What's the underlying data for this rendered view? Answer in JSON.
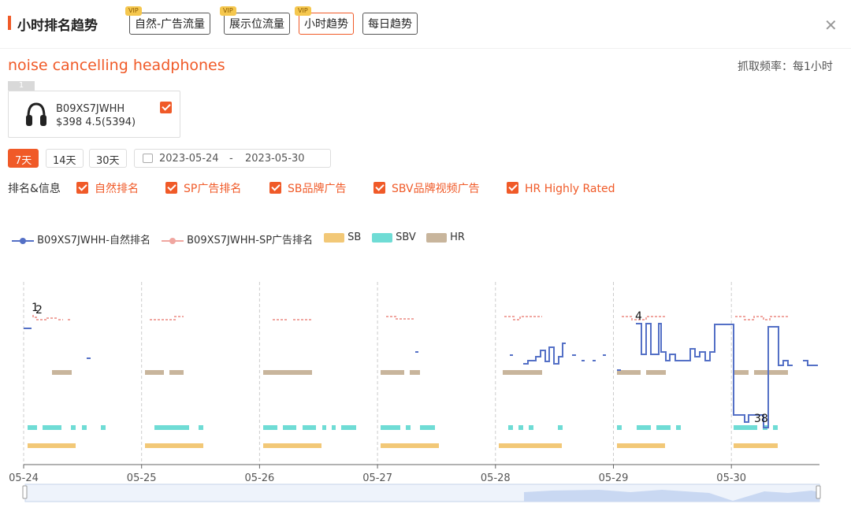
{
  "header": {
    "title": "小时排名趋势",
    "tabs": [
      {
        "label": "自然-广告流量",
        "vip": "VIP",
        "active": false
      },
      {
        "label": "展示位流量",
        "vip": "VIP",
        "active": false
      },
      {
        "label": "小时趋势",
        "vip": "VIP",
        "active": true
      },
      {
        "label": "每日趋势",
        "vip": "",
        "active": false
      }
    ],
    "close_icon": "close-icon"
  },
  "keyword": "noise cancelling headphones",
  "frequency": "抓取频率：每1小时",
  "product": {
    "tag": "1",
    "asin": "B09XS7JWHH",
    "price_rating": "$398 4.5(5394)",
    "checked": true
  },
  "range": {
    "buttons": [
      "7天",
      "14天",
      "30天"
    ],
    "active": "7天",
    "start": "2023-05-24",
    "separator": "-",
    "end": "2023-05-30"
  },
  "filters": {
    "label": "排名&信息",
    "items": [
      "自然排名",
      "SP广告排名",
      "SB品牌广告",
      "SBV品牌视频广告",
      "HR Highly Rated"
    ]
  },
  "legend": [
    {
      "name": "B09XS7JWHH-自然排名",
      "color": "#5470c6"
    },
    {
      "name": "B09XS7JWHH-SP广告排名",
      "color": "#f0a6a0"
    },
    {
      "name": "SB",
      "color": "#f2c877"
    },
    {
      "name": "SBV",
      "color": "#6fdcd5"
    },
    {
      "name": "HR",
      "color": "#c8b59c"
    }
  ],
  "chart_data": {
    "type": "line",
    "x_categories": [
      "05-24",
      "05-25",
      "05-26",
      "05-27",
      "05-28",
      "05-29",
      "05-30"
    ],
    "y_axis": "rank (inverted)",
    "grid": "vertical dashed day separators",
    "annotations": [
      {
        "text": "1",
        "day": "05-24"
      },
      {
        "text": "2",
        "day": "05-24"
      },
      {
        "text": "4",
        "day": "05-29"
      },
      {
        "text": "38",
        "day": "05-30"
      }
    ],
    "series": [
      {
        "name": "B09XS7JWHH-自然排名",
        "color": "#5470c6",
        "kind": "step-line"
      },
      {
        "name": "B09XS7JWHH-SP广告排名",
        "color": "#f0a6a0",
        "kind": "step-line"
      },
      {
        "name": "SB",
        "color": "#f2c877",
        "kind": "presence-bar"
      },
      {
        "name": "SBV",
        "color": "#6fdcd5",
        "kind": "presence-bar"
      },
      {
        "name": "HR",
        "color": "#c8b59c",
        "kind": "presence-bar"
      }
    ]
  }
}
